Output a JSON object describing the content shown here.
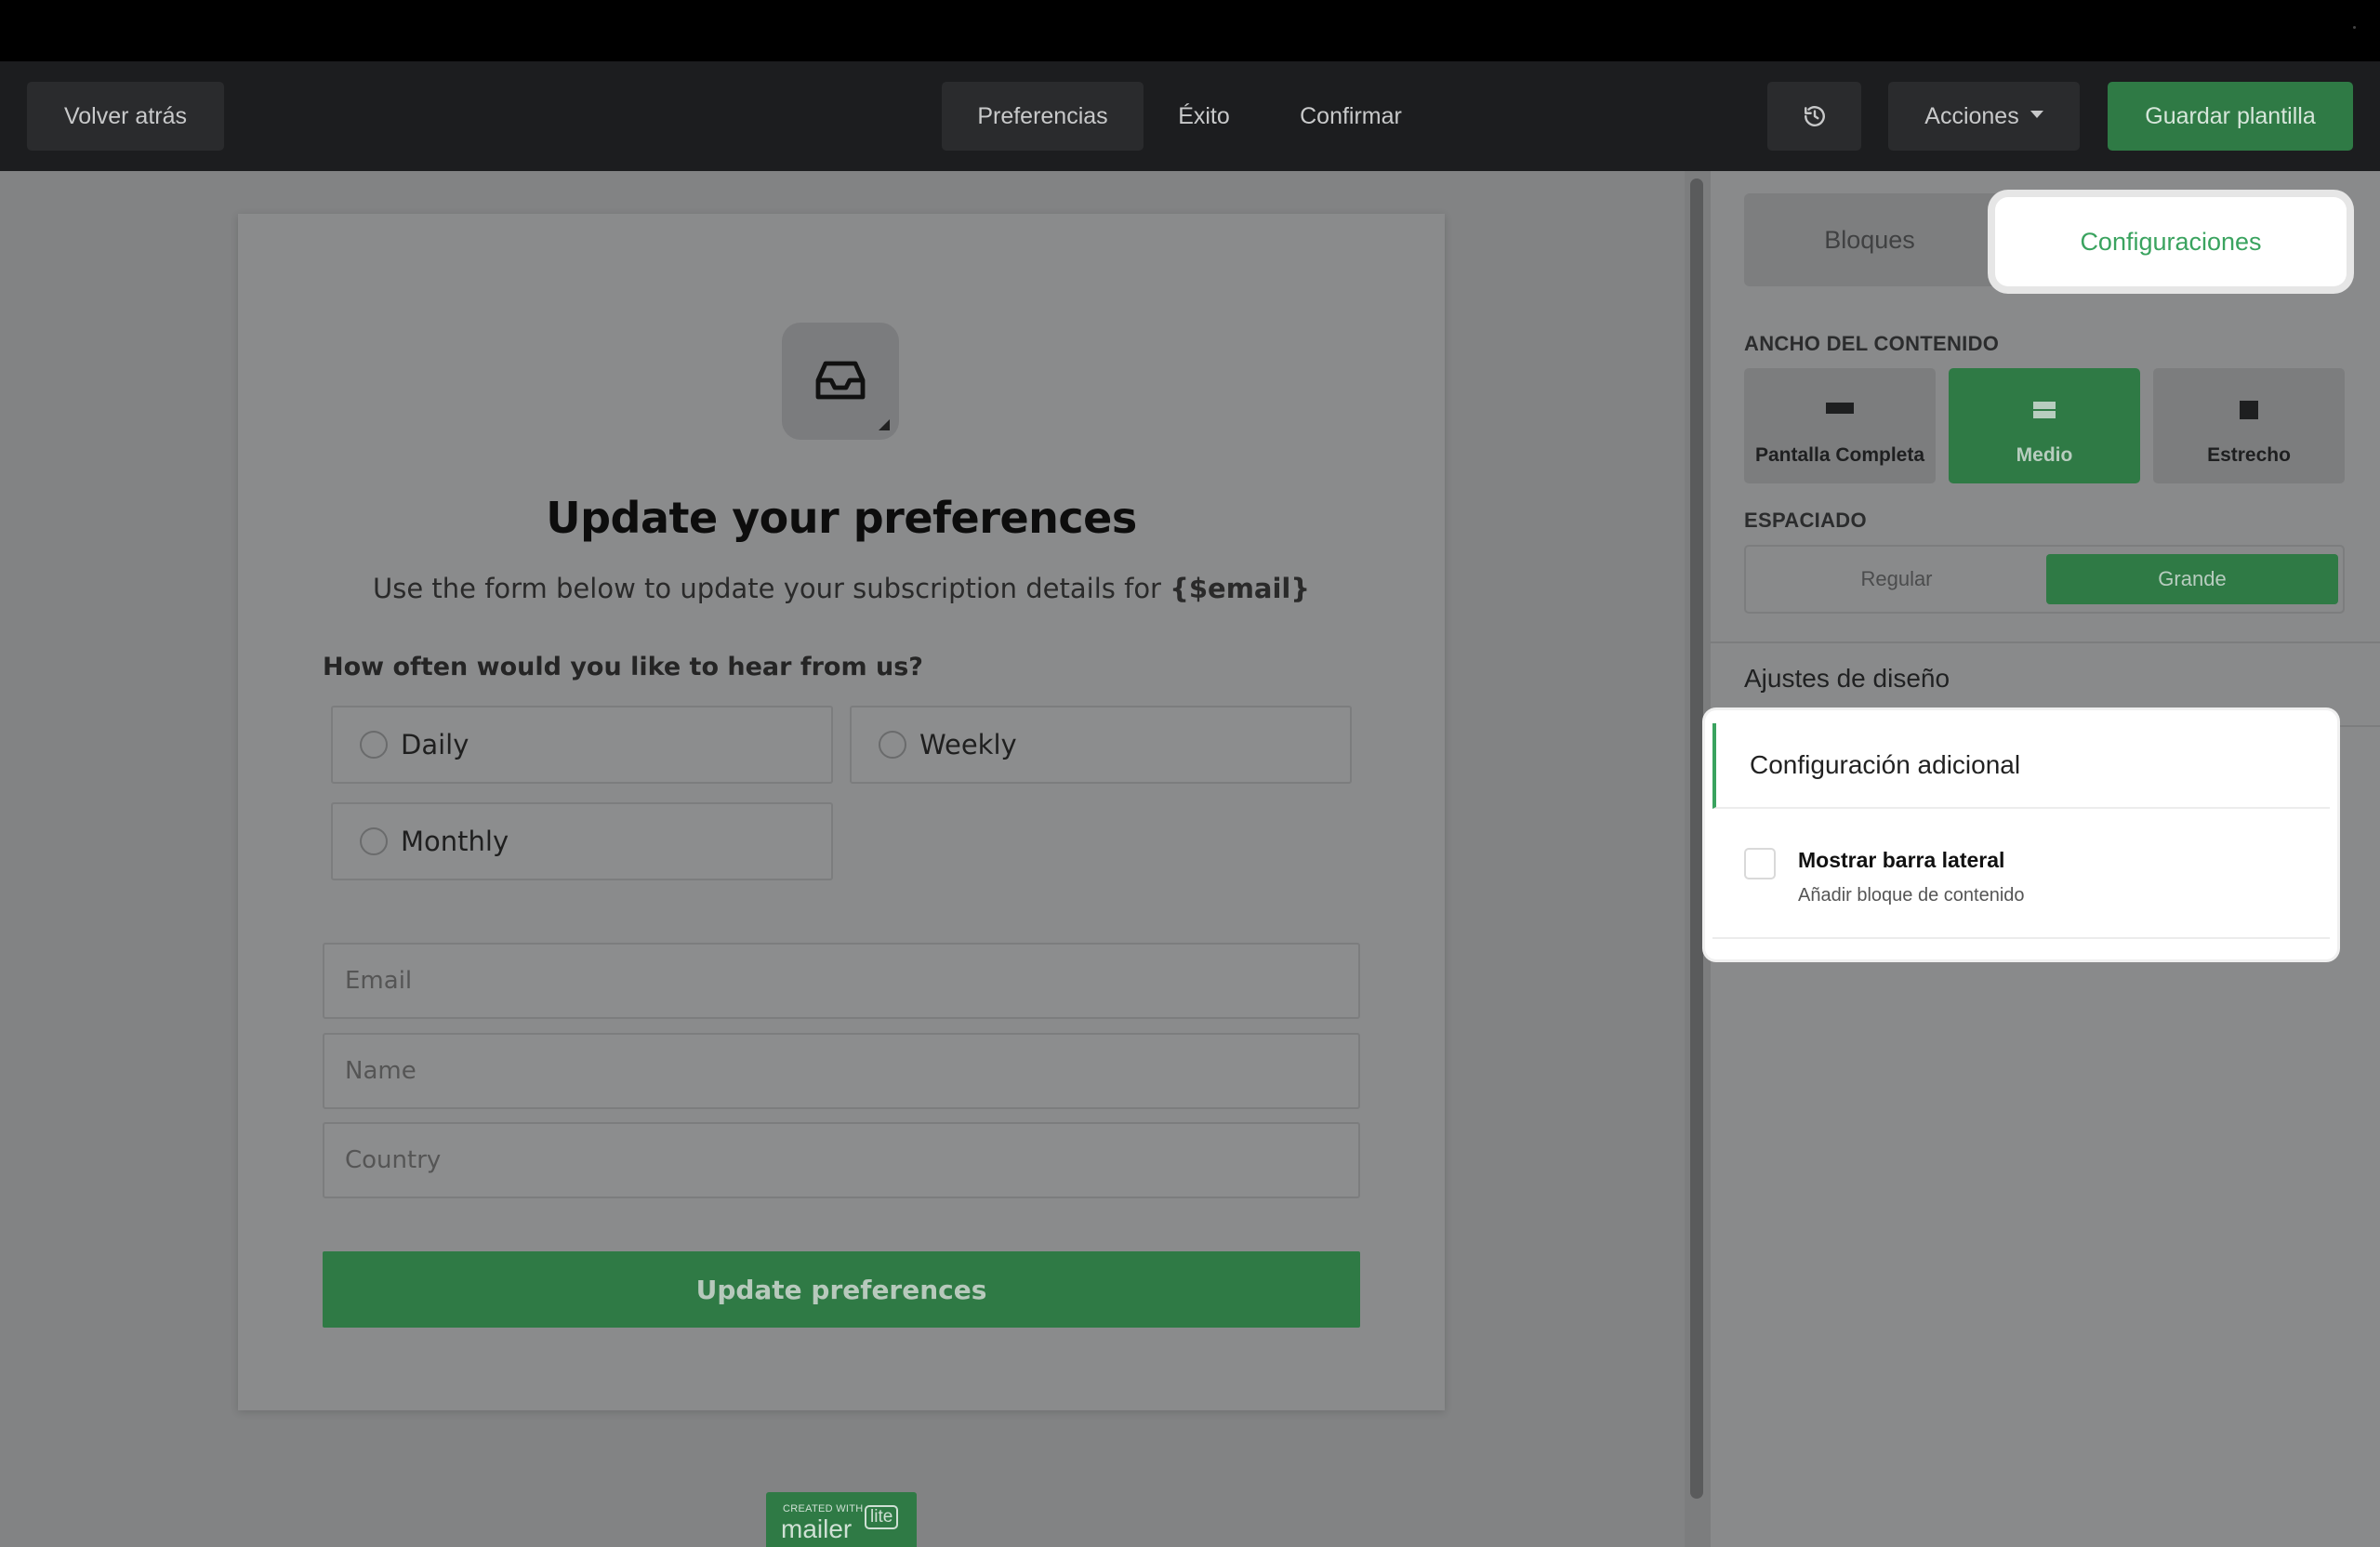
{
  "toolbar": {
    "back_label": "Volver atrás",
    "steps": [
      "Preferencias",
      "Éxito",
      "Confirmar"
    ],
    "actions_label": "Acciones",
    "save_label": "Guardar plantilla"
  },
  "form": {
    "title": "Update your preferences",
    "subtitle_prefix": "Use the form below to update your subscription details for ",
    "subtitle_var": "{$email}",
    "question": "How often would you like to hear from us?",
    "options": [
      "Daily",
      "Weekly",
      "Monthly"
    ],
    "fields": {
      "email_placeholder": "Email",
      "name_placeholder": "Name",
      "country_placeholder": "Country"
    },
    "submit_label": "Update preferences",
    "badge": {
      "small": "CREATED WITH",
      "big": "mailer",
      "lite": "lite"
    }
  },
  "panel": {
    "tabs": [
      "Bloques",
      "Configuraciones"
    ],
    "active_tab": "Configuraciones",
    "width_label": "ANCHO DEL CONTENIDO",
    "width_options": [
      "Pantalla Completa",
      "Medio",
      "Estrecho"
    ],
    "width_selected": "Medio",
    "spacing_label": "ESPACIADO",
    "spacing_options": [
      "Regular",
      "Grande"
    ],
    "spacing_selected": "Grande",
    "design_settings": "Ajustes de diseño",
    "additional": {
      "title": "Configuración adicional",
      "sidebar_label": "Mostrar barra lateral",
      "sidebar_desc": "Añadir bloque de contenido",
      "sidebar_checked": false
    }
  },
  "colors": {
    "accent": "#2f7a45",
    "highlight_text": "#3aa35f"
  }
}
